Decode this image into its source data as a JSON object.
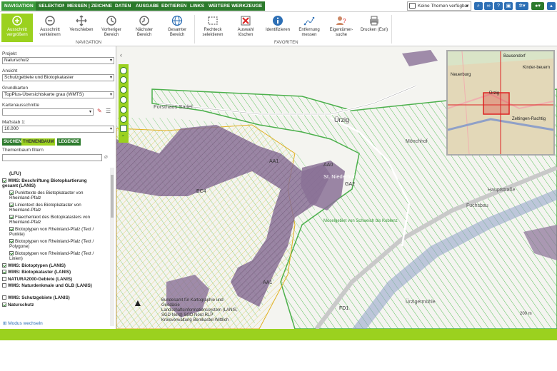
{
  "tabs": [
    "NAVIGATION",
    "SELEKTION",
    "MESSEN | ZEICHNEN",
    "DATEN",
    "AUSGABE",
    "EDITIEREN",
    "LINKS",
    "WEITERE WERKZEUGE"
  ],
  "themes_select": {
    "value": "Keine Themen verfügbar"
  },
  "ribbon": {
    "nav_buttons": [
      {
        "label": "Ausschnitt vergrößern",
        "icon": "zoom-in-icon"
      },
      {
        "label": "Ausschnitt verkleinern",
        "icon": "zoom-out-icon"
      },
      {
        "label": "Verschieben",
        "icon": "pan-icon"
      },
      {
        "label": "Vorheriger Bereich",
        "icon": "history-back-icon"
      },
      {
        "label": "Nächster Bereich",
        "icon": "history-forward-icon"
      },
      {
        "label": "Gesamter Bereich",
        "icon": "globe-icon"
      }
    ],
    "fav_buttons": [
      {
        "label": "Rechteck selektieren",
        "icon": "rectangle-select-icon"
      },
      {
        "label": "Auswahl löschen",
        "icon": "delete-selection-icon"
      },
      {
        "label": "Identifizieren",
        "icon": "info-icon"
      },
      {
        "label": "Entfernung messen",
        "icon": "measure-icon"
      },
      {
        "label": "Eigentümer-suche",
        "icon": "owner-search-icon"
      },
      {
        "label": "Drucken (Esri)",
        "icon": "printer-icon"
      }
    ],
    "group_navigation": "NAVIGATION",
    "group_favoriten": "FAVORITEN"
  },
  "sidebar": {
    "projekt_label": "Projekt",
    "projekt_value": "Naturschutz",
    "ansicht_label": "Ansicht",
    "ansicht_value": "Schutzgebiete und Biotopkataster",
    "grundkarten_label": "Grundkarten",
    "grundkarten_value": "TopPlus-Übersichtskarte grau (WMTS)",
    "kartenausschnitte_label": "Kartenausschnitte",
    "massstab_label": "Maßstab 1:",
    "massstab_value": "10.000",
    "subtabs": [
      "SUCHEN",
      "THEMENBAUM",
      "LEGENDE"
    ],
    "filter_label": "Themenbaum filtern",
    "tree": [
      {
        "text": "(LFU)",
        "bold": true,
        "checked": false,
        "indent": 1,
        "cb": false
      },
      {
        "text": "WMS: Beschriftung Biotopkartierung gesamt (LANIS)",
        "bold": true,
        "checked": true,
        "indent": 0,
        "cb": true
      },
      {
        "text": "Punkttexte des Biotopkataster von Rheinland-Pfalz",
        "bold": false,
        "checked": true,
        "indent": 1,
        "cb": true
      },
      {
        "text": "Linientext des Biotopkataster von Rheinland-Pfalz",
        "bold": false,
        "checked": true,
        "indent": 1,
        "cb": true
      },
      {
        "text": "Flaechentext des Biotopkatasters von Rheinland-Pfalz",
        "bold": false,
        "checked": true,
        "indent": 1,
        "cb": true
      },
      {
        "text": "Biotoptypen von Rheinland-Pfalz (Text / Punkte)",
        "bold": false,
        "checked": true,
        "indent": 1,
        "cb": true
      },
      {
        "text": "Biotoptypen von Rheinland-Pfalz (Text / Polygone)",
        "bold": false,
        "checked": true,
        "indent": 1,
        "cb": true
      },
      {
        "text": "Biotoptypen von Rheinland-Pfalz (Text / Linien)",
        "bold": false,
        "checked": true,
        "indent": 1,
        "cb": true
      },
      {
        "text": "WMS: Biotoptypen (LANIS)",
        "bold": true,
        "checked": true,
        "indent": 0,
        "cb": true
      },
      {
        "text": "WMS: Biotopkataster (LANIS)",
        "bold": true,
        "checked": true,
        "indent": 0,
        "cb": true
      },
      {
        "text": "NATURA2000-Gebiete (LANIS)",
        "bold": true,
        "checked": false,
        "indent": 0,
        "cb": true
      },
      {
        "text": "WMS: Naturdenkmale und GLB (LANIS)",
        "bold": true,
        "checked": false,
        "indent": 0,
        "cb": true
      },
      {
        "text": "WMS: Schutzgebiete (LANIS)",
        "bold": true,
        "checked": false,
        "indent": 0,
        "cb": true
      },
      {
        "text": "Naturschutz",
        "bold": true,
        "checked": true,
        "indent": 0,
        "cb": true
      }
    ],
    "modus_label": "Modus wechseln"
  },
  "map": {
    "labels": [
      {
        "name": "place-forsthaus",
        "text": "Forsthaus Sadel"
      },
      {
        "name": "place-urzig",
        "text": "Ürzig"
      },
      {
        "name": "place-monchhof",
        "text": "Mönchhof"
      },
      {
        "name": "place-niederhof",
        "text": "St. Niederhof"
      },
      {
        "name": "place-fuchsbau",
        "text": "Fuchsbau"
      },
      {
        "name": "place-urzigermuhle",
        "text": "Ürzigermühle"
      },
      {
        "name": "place-moselgebiet",
        "text": "Moselgebiet von Schweich bis Koblenz"
      },
      {
        "name": "label-aa0",
        "text": "AA0"
      },
      {
        "name": "label-aa1",
        "text": "AA1"
      },
      {
        "name": "label-aa1b",
        "text": "AA1"
      },
      {
        "name": "label-ga2",
        "text": "GA2"
      },
      {
        "name": "label-ec4",
        "text": "EC4"
      },
      {
        "name": "label-fd1",
        "text": "FD1"
      },
      {
        "name": "label-hauptstrasse",
        "text": "Hauptstraße"
      }
    ],
    "attribution": "Bundesamt für Kartographie und Geodäsie Landschaftsinformationssystem (LANIS, SGD Nord) SGD Nord RLP Kreisverwaltung Bernkastel-Wittlich",
    "scale_label": "200 m",
    "overview_labels": [
      "Bausendorf",
      "Kinder-beuern",
      "Neuerburg",
      "Zeltingen-Rachtig",
      "Ürzig"
    ]
  },
  "colors": {
    "nav_green": "#2c7a2c",
    "lime": "#9bd11f",
    "purple": "#8a7197",
    "hatch_green": "#5cc25c",
    "hatch_yellow": "#e0c44a",
    "blue": "#2d6fb5"
  }
}
